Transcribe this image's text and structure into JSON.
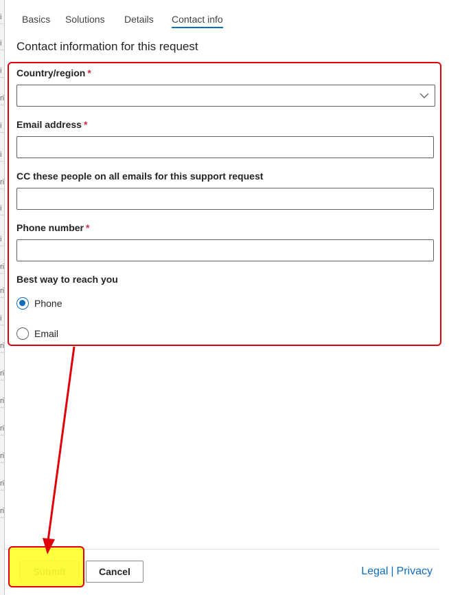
{
  "tabs": [
    {
      "label": "Basics",
      "active": false
    },
    {
      "label": "Solutions",
      "active": false
    },
    {
      "label": "Details",
      "active": false
    },
    {
      "label": "Contact info",
      "active": true
    }
  ],
  "section_title": "Contact information for this request",
  "form": {
    "country": {
      "label": "Country/region",
      "required_mark": "*",
      "value": ""
    },
    "email": {
      "label": "Email address",
      "required_mark": "*",
      "value": ""
    },
    "cc": {
      "label": "CC these people on all emails for this support request",
      "value": ""
    },
    "phone": {
      "label": "Phone number",
      "required_mark": "*",
      "value": ""
    },
    "contact_method": {
      "label": "Best way to reach you",
      "options": [
        {
          "label": "Phone",
          "selected": true
        },
        {
          "label": "Email",
          "selected": false
        }
      ]
    }
  },
  "footer": {
    "submit_label": "Submit",
    "cancel_label": "Cancel",
    "legal_label": "Legal",
    "separator": "|",
    "privacy_label": "Privacy"
  },
  "background_strip_chars": [
    "i",
    "i",
    "i",
    "ri",
    "i",
    "i",
    "ri",
    "i",
    "i",
    "ri",
    "ri",
    "i",
    "ri",
    "ri",
    "ri",
    "ri",
    "ri",
    "ri",
    "ri"
  ],
  "colors": {
    "accent": "#0f6cbd",
    "annotation_red": "#e0000c",
    "highlight_yellow": "#ffff00",
    "required_red": "#c4314b"
  }
}
